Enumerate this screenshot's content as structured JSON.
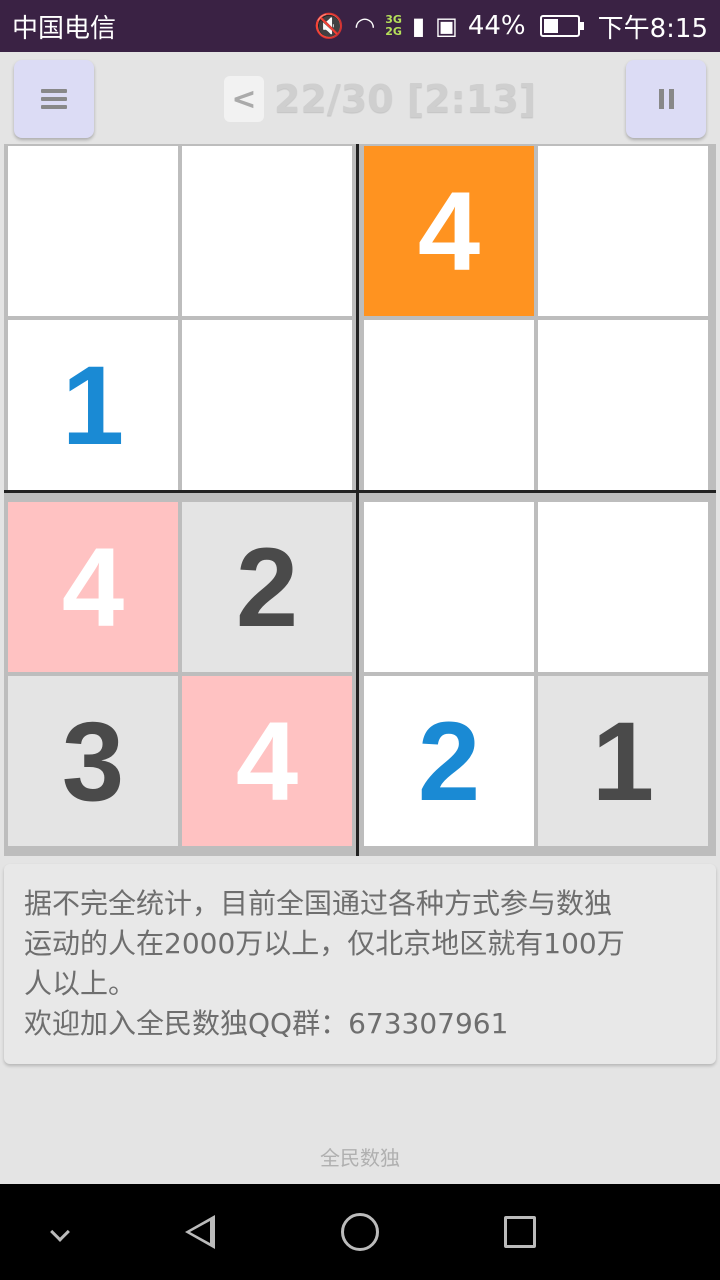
{
  "status_bar": {
    "carrier": "中国电信",
    "network_labels": [
      "3G",
      "2G"
    ],
    "battery_percent": "44%",
    "battery_level": 0.44,
    "time": "下午8:15"
  },
  "toolbar": {
    "back_label": "<",
    "progress": "22/30 [2:13]"
  },
  "board": {
    "size": 4,
    "rows": [
      [
        {
          "value": "",
          "state": "empty"
        },
        {
          "value": "",
          "state": "empty"
        },
        {
          "value": "4",
          "state": "selected"
        },
        {
          "value": "",
          "state": "empty"
        }
      ],
      [
        {
          "value": "1",
          "state": "user"
        },
        {
          "value": "",
          "state": "empty"
        },
        {
          "value": "",
          "state": "empty"
        },
        {
          "value": "",
          "state": "empty"
        }
      ],
      [
        {
          "value": "4",
          "state": "conflict"
        },
        {
          "value": "2",
          "state": "given"
        },
        {
          "value": "",
          "state": "empty"
        },
        {
          "value": "",
          "state": "empty"
        }
      ],
      [
        {
          "value": "3",
          "state": "given"
        },
        {
          "value": "4",
          "state": "conflict"
        },
        {
          "value": "2",
          "state": "user"
        },
        {
          "value": "1",
          "state": "given"
        }
      ]
    ],
    "colors": {
      "selected": "#ff9320",
      "conflict": "#ffc2c2",
      "given": "#e4e4e4",
      "user_text": "#1a8ad4"
    }
  },
  "info": {
    "line1": "据不完全统计，目前全国通过各种方式参与数独",
    "line2": "运动的人在2000万以上，仅北京地区就有100万",
    "line3": "人以上。",
    "line4": "欢迎加入全民数独QQ群：673307961"
  },
  "footer": {
    "app_name": "全民数独"
  },
  "icons": {
    "menu": "hamburger-menu-icon",
    "pause": "pause-icon",
    "nav_down": "chevron-down-icon",
    "nav_back": "back-triangle-icon",
    "nav_home": "home-circle-icon",
    "nav_recent": "recent-apps-icon"
  }
}
